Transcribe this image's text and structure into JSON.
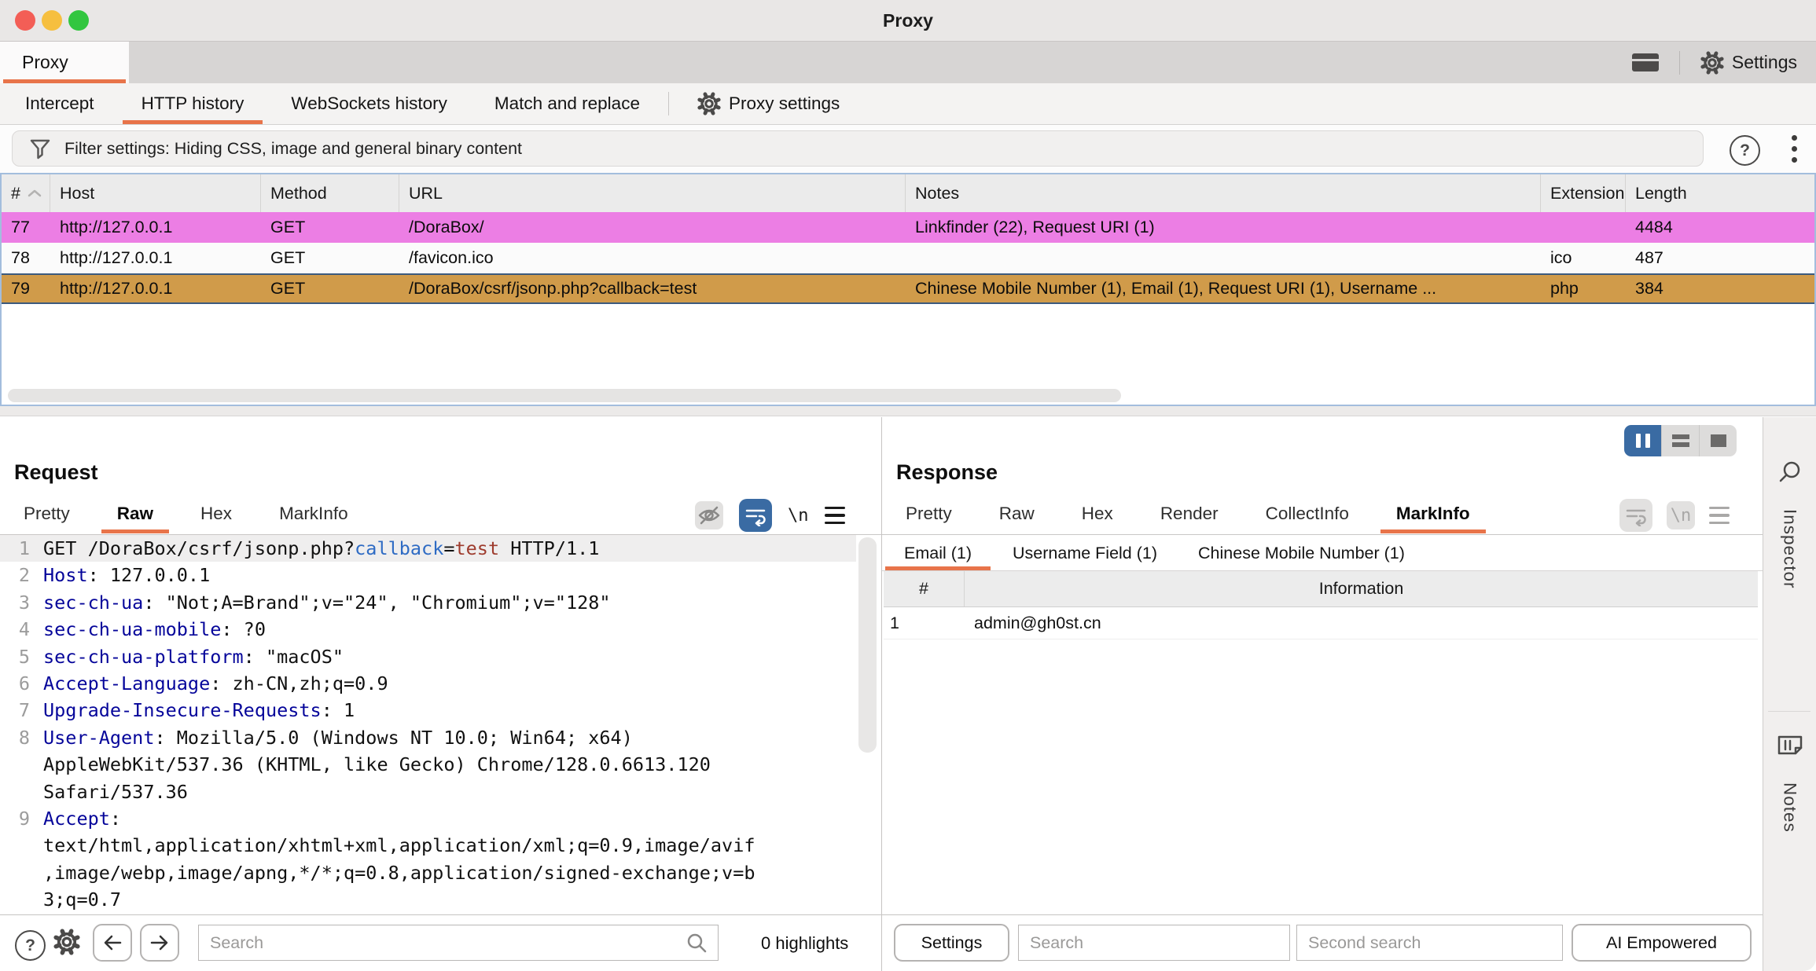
{
  "window": {
    "title": "Proxy"
  },
  "main_tabs": {
    "proxy_label": "Proxy",
    "settings_label": "Settings"
  },
  "sub_tabs": [
    {
      "label": "Intercept",
      "active": false
    },
    {
      "label": "HTTP history",
      "active": true
    },
    {
      "label": "WebSockets history",
      "active": false
    },
    {
      "label": "Match and replace",
      "active": false
    },
    {
      "label": "Proxy settings",
      "active": false,
      "gear": true,
      "divider_before": true
    }
  ],
  "filter": {
    "text": "Filter settings: Hiding CSS, image and general binary content"
  },
  "history_table": {
    "columns": [
      "#",
      "Host",
      "Method",
      "URL",
      "Notes",
      "Extension",
      "Length"
    ],
    "rows": [
      {
        "id": "77",
        "host": "http://127.0.0.1",
        "method": "GET",
        "url": "/DoraBox/",
        "notes": "Linkfinder (22), Request URI (1)",
        "extension": "",
        "length": "4484",
        "color": "pink",
        "selected": false
      },
      {
        "id": "78",
        "host": "http://127.0.0.1",
        "method": "GET",
        "url": "/favicon.ico",
        "notes": "",
        "extension": "ico",
        "length": "487",
        "color": "white",
        "selected": false
      },
      {
        "id": "79",
        "host": "http://127.0.0.1",
        "method": "GET",
        "url": "/DoraBox/csrf/jsonp.php?callback=test",
        "notes": "Chinese Mobile Number (1), Email (1), Request URI (1), Username ...",
        "extension": "php",
        "length": "384",
        "color": "orange",
        "selected": true
      }
    ]
  },
  "request": {
    "title": "Request",
    "tabs": [
      {
        "label": "Pretty",
        "active": false
      },
      {
        "label": "Raw",
        "active": true
      },
      {
        "label": "Hex",
        "active": false
      },
      {
        "label": "MarkInfo",
        "active": false
      }
    ],
    "newline_label": "\\n",
    "lines": [
      {
        "num": "1",
        "hl": true,
        "seg": [
          [
            "t",
            "GET /DoraBox/csrf/jsonp.php?"
          ],
          [
            "p",
            "callback"
          ],
          [
            "t",
            "="
          ],
          [
            "v",
            "test"
          ],
          [
            "t",
            " HTTP/1.1"
          ]
        ]
      },
      {
        "num": "2",
        "hl": false,
        "seg": [
          [
            "k",
            "Host"
          ],
          [
            "t",
            ": 127.0.0.1"
          ]
        ]
      },
      {
        "num": "3",
        "hl": false,
        "seg": [
          [
            "k",
            "sec-ch-ua"
          ],
          [
            "t",
            ": \"Not;A=Brand\";v=\"24\", \"Chromium\";v=\"128\""
          ]
        ]
      },
      {
        "num": "4",
        "hl": false,
        "seg": [
          [
            "k",
            "sec-ch-ua-mobile"
          ],
          [
            "t",
            ": ?0"
          ]
        ]
      },
      {
        "num": "5",
        "hl": false,
        "seg": [
          [
            "k",
            "sec-ch-ua-platform"
          ],
          [
            "t",
            ": \"macOS\""
          ]
        ]
      },
      {
        "num": "6",
        "hl": false,
        "seg": [
          [
            "k",
            "Accept-Language"
          ],
          [
            "t",
            ": zh-CN,zh;q=0.9"
          ]
        ]
      },
      {
        "num": "7",
        "hl": false,
        "seg": [
          [
            "k",
            "Upgrade-Insecure-Requests"
          ],
          [
            "t",
            ": 1"
          ]
        ]
      },
      {
        "num": "8",
        "hl": false,
        "seg": [
          [
            "k",
            "User-Agent"
          ],
          [
            "t",
            ": Mozilla/5.0 (Windows NT 10.0; Win64; x64)"
          ]
        ]
      },
      {
        "num": "",
        "hl": false,
        "seg": [
          [
            "t",
            "AppleWebKit/537.36 (KHTML, like Gecko) Chrome/128.0.6613.120"
          ]
        ]
      },
      {
        "num": "",
        "hl": false,
        "seg": [
          [
            "t",
            "Safari/537.36"
          ]
        ]
      },
      {
        "num": "9",
        "hl": false,
        "seg": [
          [
            "k",
            "Accept"
          ],
          [
            "t",
            ":"
          ]
        ]
      },
      {
        "num": "",
        "hl": false,
        "seg": [
          [
            "t",
            "text/html,application/xhtml+xml,application/xml;q=0.9,image/avif"
          ]
        ]
      },
      {
        "num": "",
        "hl": false,
        "seg": [
          [
            "t",
            ",image/webp,image/apng,*/*;q=0.8,application/signed-exchange;v=b"
          ]
        ]
      },
      {
        "num": "",
        "hl": false,
        "seg": [
          [
            "t",
            "3;q=0.7"
          ]
        ]
      }
    ],
    "search": {
      "placeholder": "Search"
    },
    "highlights_label": "0 highlights"
  },
  "response": {
    "title": "Response",
    "tabs": [
      {
        "label": "Pretty",
        "active": false
      },
      {
        "label": "Raw",
        "active": false
      },
      {
        "label": "Hex",
        "active": false
      },
      {
        "label": "Render",
        "active": false
      },
      {
        "label": "CollectInfo",
        "active": false
      },
      {
        "label": "MarkInfo",
        "active": true
      }
    ],
    "newline_label": "\\n",
    "mark_tabs": [
      {
        "label": "Email (1)",
        "active": true
      },
      {
        "label": "Username Field (1)",
        "active": false
      },
      {
        "label": "Chinese Mobile Number (1)",
        "active": false
      }
    ],
    "info_table": {
      "columns": [
        "#",
        "Information"
      ],
      "rows": [
        {
          "id": "1",
          "info": "admin@gh0st.cn"
        }
      ]
    },
    "bottom": {
      "settings_label": "Settings",
      "search_placeholder": "Search",
      "second_search_placeholder": "Second search",
      "ai_label": "AI Empowered"
    }
  },
  "sidebar": {
    "items": [
      {
        "label": "Inspector"
      },
      {
        "label": "Notes"
      }
    ]
  },
  "colors": {
    "accent": "#e8744a",
    "row_pink": "#ec7ee4",
    "row_orange": "#d09b4a",
    "selection_border": "#3c5a7d",
    "blue_button": "#3a6ba3",
    "table_border": "#a3bddd",
    "header_key": "#05059a",
    "param_blue": "#2e6bc4",
    "value_red": "#9e3b2d",
    "traffic_red": "#f35e56",
    "traffic_yellow": "#f6bf3f",
    "traffic_green": "#32c63f"
  }
}
